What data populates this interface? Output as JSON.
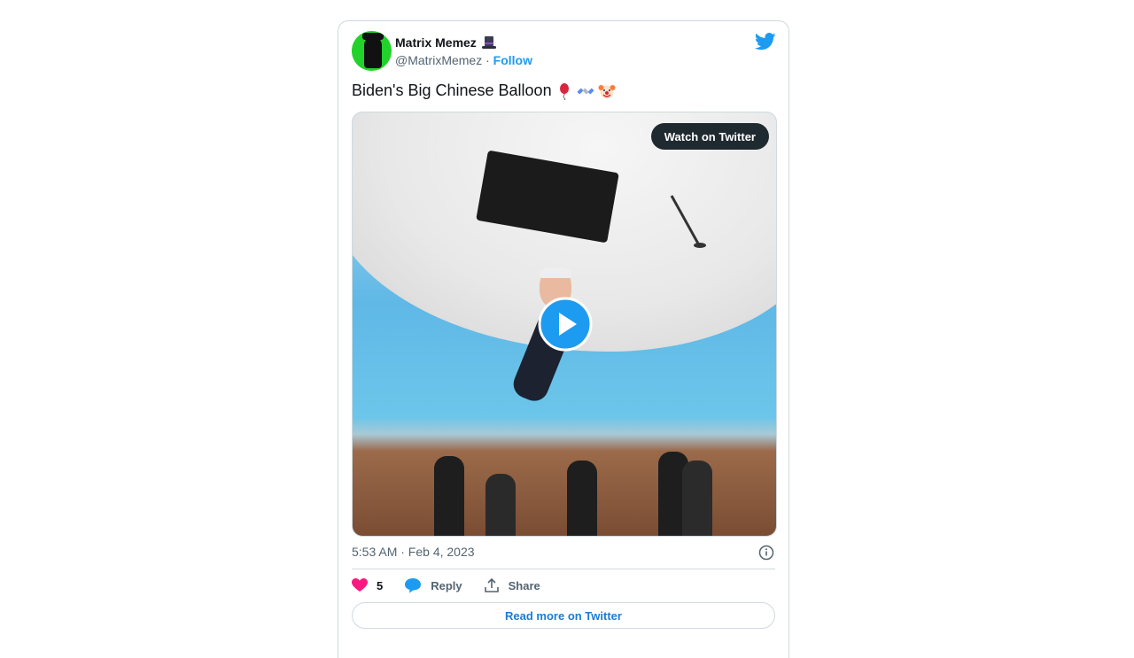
{
  "tweet": {
    "author_name": "Matrix Memez",
    "handle": "@MatrixMemez",
    "separator": "·",
    "follow_label": "Follow",
    "text": "Biden's Big Chinese Balloon",
    "text_emojis": [
      "balloon",
      "satellite",
      "clown-face"
    ]
  },
  "media": {
    "watch_label": "Watch on Twitter"
  },
  "meta": {
    "timestamp": "5:53 AM · Feb 4, 2023"
  },
  "actions": {
    "like_count": "5",
    "reply_label": "Reply",
    "share_label": "Share"
  },
  "footer": {
    "read_more_label": "Read more on Twitter"
  },
  "colors": {
    "accent": "#1d9bf0",
    "like": "#f91880",
    "border": "#cfd9de",
    "muted": "#536471"
  }
}
